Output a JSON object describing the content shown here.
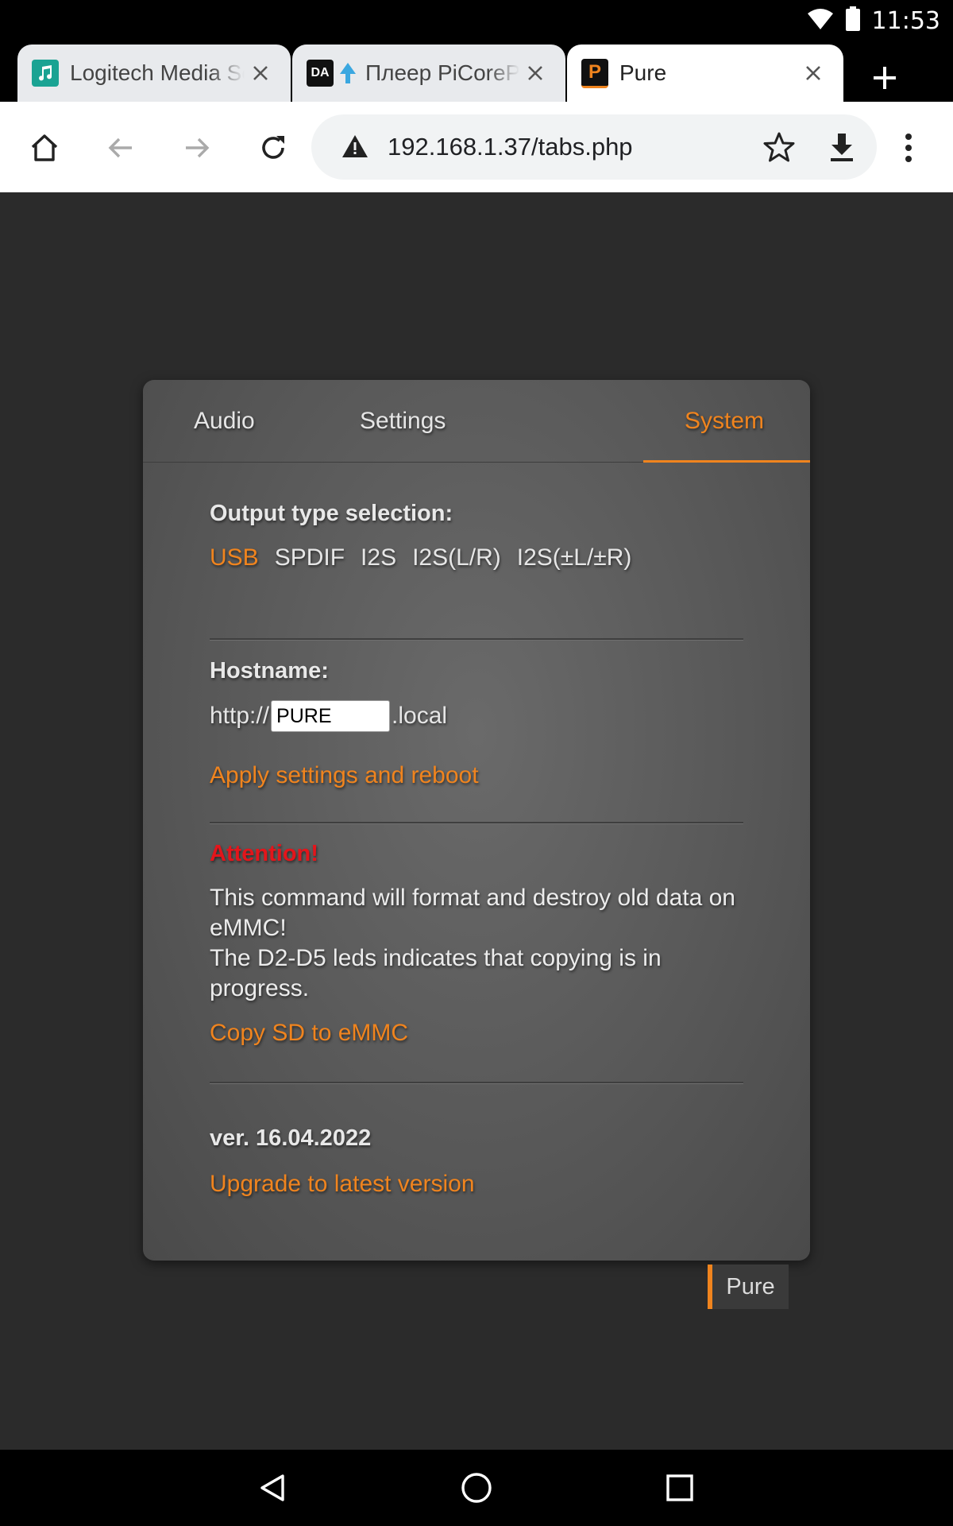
{
  "status_bar": {
    "time": "11:53",
    "battery_label": "100",
    "icons": [
      "wifi-icon",
      "battery-icon"
    ]
  },
  "browser": {
    "tabs": [
      {
        "title": "Logitech Media Server",
        "favicon": "lms-icon",
        "active": false
      },
      {
        "title": "Плеер PiCorePlayer",
        "favicon_text": "DA",
        "active": false
      },
      {
        "title": "Pure",
        "favicon_text": "P",
        "active": true
      }
    ],
    "url": "192.168.1.37/tabs.php"
  },
  "panel": {
    "tabs": [
      {
        "label": "Audio",
        "selected": false
      },
      {
        "label": "Settings",
        "selected": false
      },
      {
        "label": "System",
        "selected": true
      }
    ],
    "output": {
      "heading": "Output type selection:",
      "options": [
        "USB",
        "SPDIF",
        "I2S",
        "I2S(L/R)",
        "I2S(±L/±R)"
      ],
      "selected": "USB"
    },
    "hostname": {
      "heading": "Hostname:",
      "prefix": "http://",
      "value": "PURE",
      "suffix": ".local",
      "apply_label": "Apply settings and reboot"
    },
    "emmc": {
      "attention": "Attention!",
      "message_line1": "This command will format and destroy old data on eMMC!",
      "message_line2": "The D2-D5 leds indicates that copying is in progress.",
      "copy_label": "Copy SD to eMMC"
    },
    "version": {
      "text": "ver. 16.04.2022",
      "upgrade_label": "Upgrade to latest version"
    }
  },
  "badge": {
    "label": "Pure"
  },
  "colors": {
    "accent": "#f0841e",
    "attention": "#e4151b",
    "background": "#2b2b2b"
  }
}
